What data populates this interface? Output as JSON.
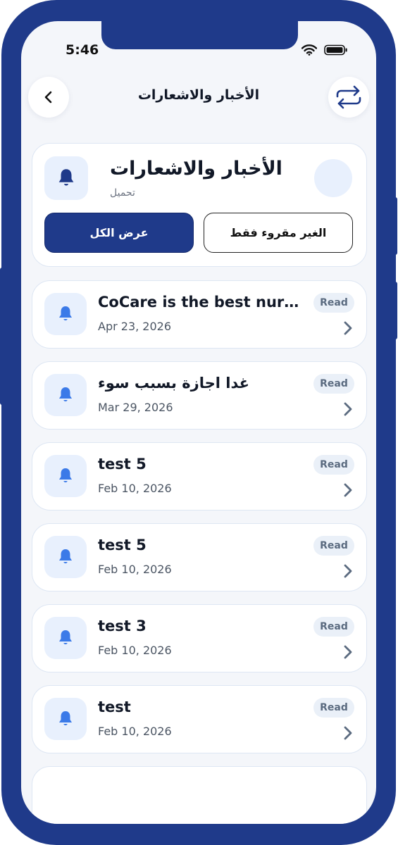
{
  "status_bar": {
    "time": "5:46"
  },
  "header": {
    "title": "الأخبار والاشعارات"
  },
  "icons": {
    "back": "chevron-left-icon",
    "refresh": "repeat-icon",
    "bell": "bell-icon",
    "arrow": "chevron-right-icon"
  },
  "summary_card": {
    "title": "الأخبار والاشعارات",
    "subtitle": "تحميل",
    "filters": {
      "all_label": "عرض الكل",
      "unread_label": "الغير مقروء فقط",
      "active": "all"
    }
  },
  "notifications": [
    {
      "title": "CoCare is the best nurser...",
      "date": "Apr 23, 2026",
      "status": "Read"
    },
    {
      "title": "غدا اجازة بسبب سوء",
      "date": "Mar 29, 2026",
      "status": "Read"
    },
    {
      "title": "test 5",
      "date": "Feb 10, 2026",
      "status": "Read"
    },
    {
      "title": "test 5",
      "date": "Feb 10, 2026",
      "status": "Read"
    },
    {
      "title": "test 3",
      "date": "Feb 10, 2026",
      "status": "Read"
    },
    {
      "title": "test",
      "date": "Feb 10, 2026",
      "status": "Read"
    }
  ],
  "colors": {
    "brand": "#1f3a8a",
    "bell_accent": "#3b7ae8",
    "background": "#f4f6fa",
    "icon_bg": "#e8f0fd"
  }
}
